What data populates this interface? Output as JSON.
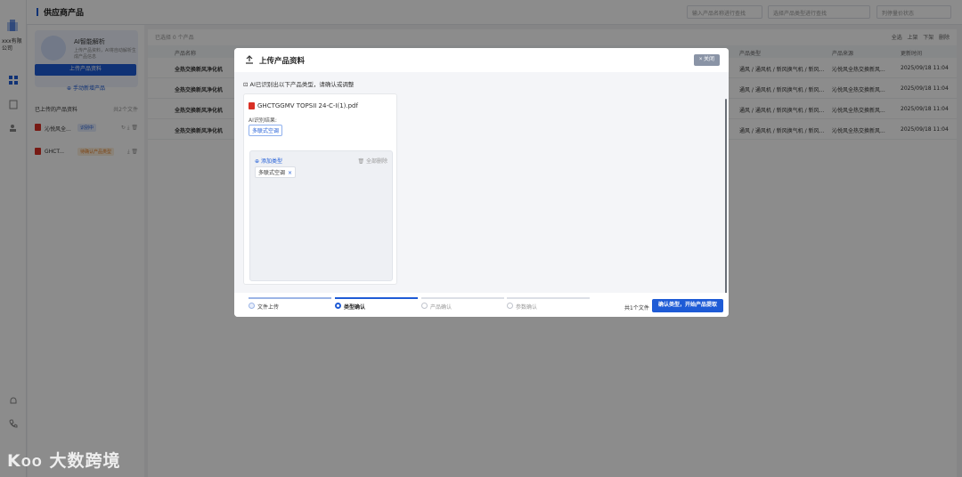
{
  "app": {
    "company": "xxx有限公司",
    "page_title": "供应商产品"
  },
  "header": {
    "search_placeholder": "输入产品名称进行查找",
    "filter1_placeholder": "选择产品类型进行查找",
    "filter2_placeholder": "判停量价状态"
  },
  "left_panel": {
    "ai_title": "AI智能解析",
    "ai_desc": "上传产品资料，AI将自动解析生成产品信息",
    "upload_label": "上传产品资料",
    "add_link": "手动新增产品",
    "uploaded_title": "已上传的产品资料",
    "uploaded_count": "共2个文件",
    "files": [
      {
        "name": "沁悦风全...",
        "tag": "识别中"
      },
      {
        "name": "GHCT...",
        "tag": "待确认产品类型"
      }
    ]
  },
  "main": {
    "selected_info": "已选择 0 个产品",
    "tools": [
      "全选",
      "上架",
      "下架",
      "删除"
    ],
    "columns": [
      "产品名称",
      "产品类型",
      "产品来源",
      "更新时间"
    ],
    "rows": [
      {
        "name": "全热交换新风净化机",
        "type": "通风 / 通风机 / 新风换气机 / 新风...",
        "source": "沁悦风全热交换新风...",
        "time": "2025/09/18 11:04"
      },
      {
        "name": "全热交换新风净化机",
        "type": "通风 / 通风机 / 新风换气机 / 新风...",
        "source": "沁悦风全热交换新风...",
        "time": "2025/09/18 11:04"
      },
      {
        "name": "全热交换新风净化机",
        "type": "通风 / 通风机 / 新风换气机 / 新风...",
        "source": "沁悦风全热交换新风...",
        "time": "2025/09/18 11:04"
      },
      {
        "name": "全热交换新风净化机",
        "type": "通风 / 通风机 / 新风换气机 / 新风...",
        "source": "沁悦风全热交换新风...",
        "time": "2025/09/18 11:04"
      }
    ]
  },
  "modal": {
    "title": "上传产品资料",
    "close_label": "关闭",
    "hint": "AI已识别出以下产品类型，请确认或调整",
    "file_name": "GHCTGGMV TOPSII 24-C-I(1).pdf",
    "result_label": "AI识别结果:",
    "result_chip": "多联式空调",
    "add_type": "添加类型",
    "delete_all": "全部删除",
    "selected_tag": "多联式空调",
    "steps": [
      "文件上传",
      "类型确认",
      "产品确认",
      "参数确认"
    ],
    "file_count": "共1个文件",
    "confirm_label": "确认类型，开始产品提取"
  },
  "watermark": "大数跨境",
  "colors": {
    "primary": "#1e5bd6",
    "overlay": "rgba(0,0,0,0.45)",
    "pdf_red": "#d93025"
  }
}
